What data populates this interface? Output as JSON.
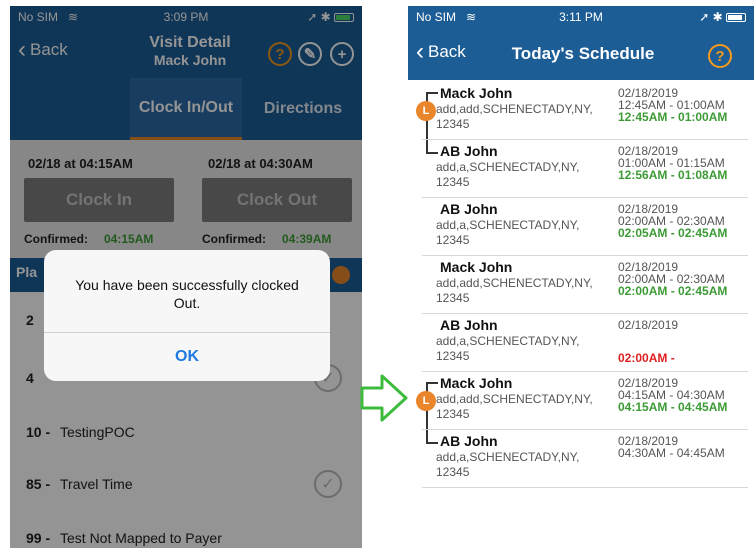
{
  "left": {
    "status": {
      "carrier": "No SIM",
      "time": "3:09 PM"
    },
    "nav": {
      "back": "Back",
      "title": "Visit Detail",
      "subtitle": "Mack John"
    },
    "tabs": [
      {
        "label": "Clock In/Out"
      },
      {
        "label": "Directions"
      }
    ],
    "clock": {
      "in_time": "02/18 at 04:15AM",
      "out_time": "02/18 at 04:30AM",
      "in_button": "Clock In",
      "out_button": "Clock Out",
      "confirmed_label": "Confirmed:",
      "in_confirmed": "04:15AM",
      "out_confirmed": "04:39AM"
    },
    "partial_label": "Pla",
    "tasks": [
      {
        "num": "2",
        "text": ""
      },
      {
        "num": "4",
        "text": ""
      },
      {
        "num": "10 -",
        "text": "TestingPOC"
      },
      {
        "num": "85 -",
        "text": "Travel Time"
      },
      {
        "num": "99 -",
        "text": "Test Not Mapped to Payer"
      }
    ],
    "alert": {
      "message": "You have been successfully clocked Out.",
      "button": "OK"
    }
  },
  "right": {
    "status": {
      "carrier": "No SIM",
      "time": "3:11 PM"
    },
    "nav": {
      "back": "Back",
      "title": "Today's Schedule"
    },
    "visits": [
      {
        "name": "Mack John",
        "address": "add,add,SCHENECTADY,NY, 12345",
        "date": "02/18/2019",
        "scheduled": "12:45AM - 01:00AM",
        "actual": "12:45AM - 01:00AM",
        "badge": "L"
      },
      {
        "name": "AB John",
        "address": "add,a,SCHENECTADY,NY, 12345",
        "date": "02/18/2019",
        "scheduled": "01:00AM - 01:15AM",
        "actual": "12:56AM - 01:08AM",
        "badge": ""
      },
      {
        "name": "AB John",
        "address": "add,a,SCHENECTADY,NY, 12345",
        "date": "02/18/2019",
        "scheduled": "02:00AM - 02:30AM",
        "actual": "02:05AM - 02:45AM",
        "badge": ""
      },
      {
        "name": "Mack John",
        "address": "add,add,SCHENECTADY,NY, 12345",
        "date": "02/18/2019",
        "scheduled": "02:00AM - 02:30AM",
        "actual": "02:00AM - 02:45AM",
        "badge": ""
      },
      {
        "name": "AB John",
        "address": "add,a,SCHENECTADY,NY, 12345",
        "date": "02/18/2019",
        "scheduled": "",
        "actual": "02:00AM -",
        "badge": ""
      },
      {
        "name": "Mack John",
        "address": "add,add,SCHENECTADY,NY, 12345",
        "date": "02/18/2019",
        "scheduled": "04:15AM - 04:30AM",
        "actual": "04:15AM - 04:45AM",
        "badge": "L"
      },
      {
        "name": "AB John",
        "address": "add,a,SCHENECTADY,NY, 12345",
        "date": "02/18/2019",
        "scheduled": "04:30AM - 04:45AM",
        "actual": "",
        "badge": ""
      }
    ]
  },
  "colors": {
    "nav": "#1d5d96",
    "accent": "#e9852a",
    "confirmed": "#3c9b35",
    "late": "#e02020",
    "arrow": "#3dbb3d"
  }
}
